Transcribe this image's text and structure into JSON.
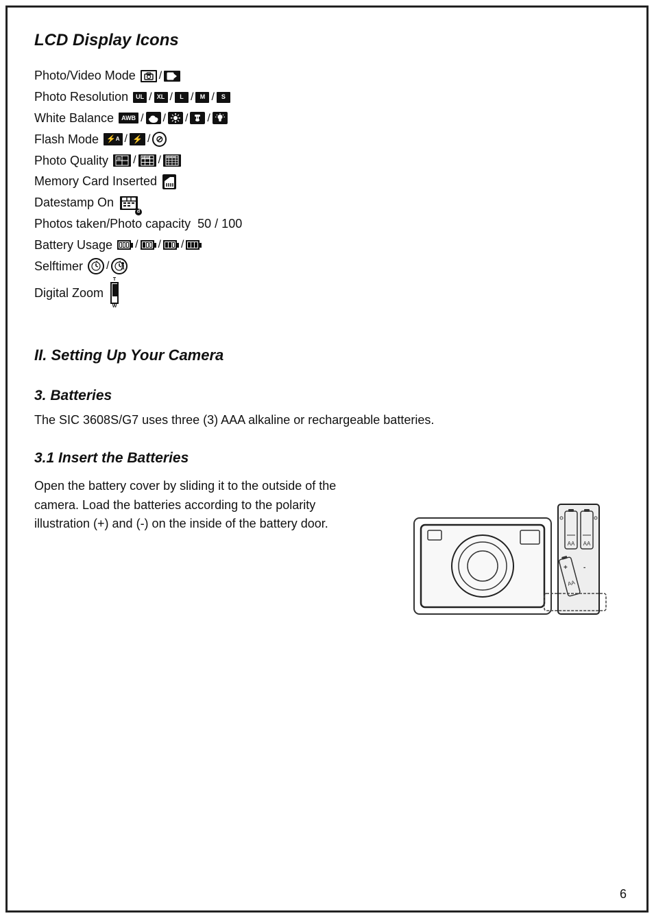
{
  "page": {
    "number": "6",
    "border": true
  },
  "section1": {
    "title": "LCD Display Icons",
    "items": [
      {
        "label": "Photo/Video Mode",
        "id": "photo-video-mode"
      },
      {
        "label": "Photo Resolution",
        "id": "photo-resolution"
      },
      {
        "label": "White Balance",
        "id": "white-balance"
      },
      {
        "label": "Flash Mode",
        "id": "flash-mode"
      },
      {
        "label": "Photo Quality",
        "id": "photo-quality"
      },
      {
        "label": "Memory Card Inserted",
        "id": "memory-card"
      },
      {
        "label": "Datestamp On",
        "id": "datestamp"
      },
      {
        "label": "Photos taken/Photo capacity",
        "id": "photo-capacity",
        "value": "50 / 100"
      },
      {
        "label": "Battery Usage",
        "id": "battery-usage"
      },
      {
        "label": "Selftimer",
        "id": "selftimer"
      },
      {
        "label": "Digital Zoom",
        "id": "digital-zoom"
      }
    ]
  },
  "section2": {
    "title": "II. Setting Up Your Camera"
  },
  "section3": {
    "title": "3. Batteries",
    "body": "The SIC 3608S/G7 uses three (3) AAA alkaline or rechargeable batteries."
  },
  "section4": {
    "title": "3.1 Insert the Batteries",
    "body": "Open the battery cover by sliding it to the outside of the camera. Load the batteries according to the polarity illustration (+) and (-) on the inside of the battery door."
  }
}
